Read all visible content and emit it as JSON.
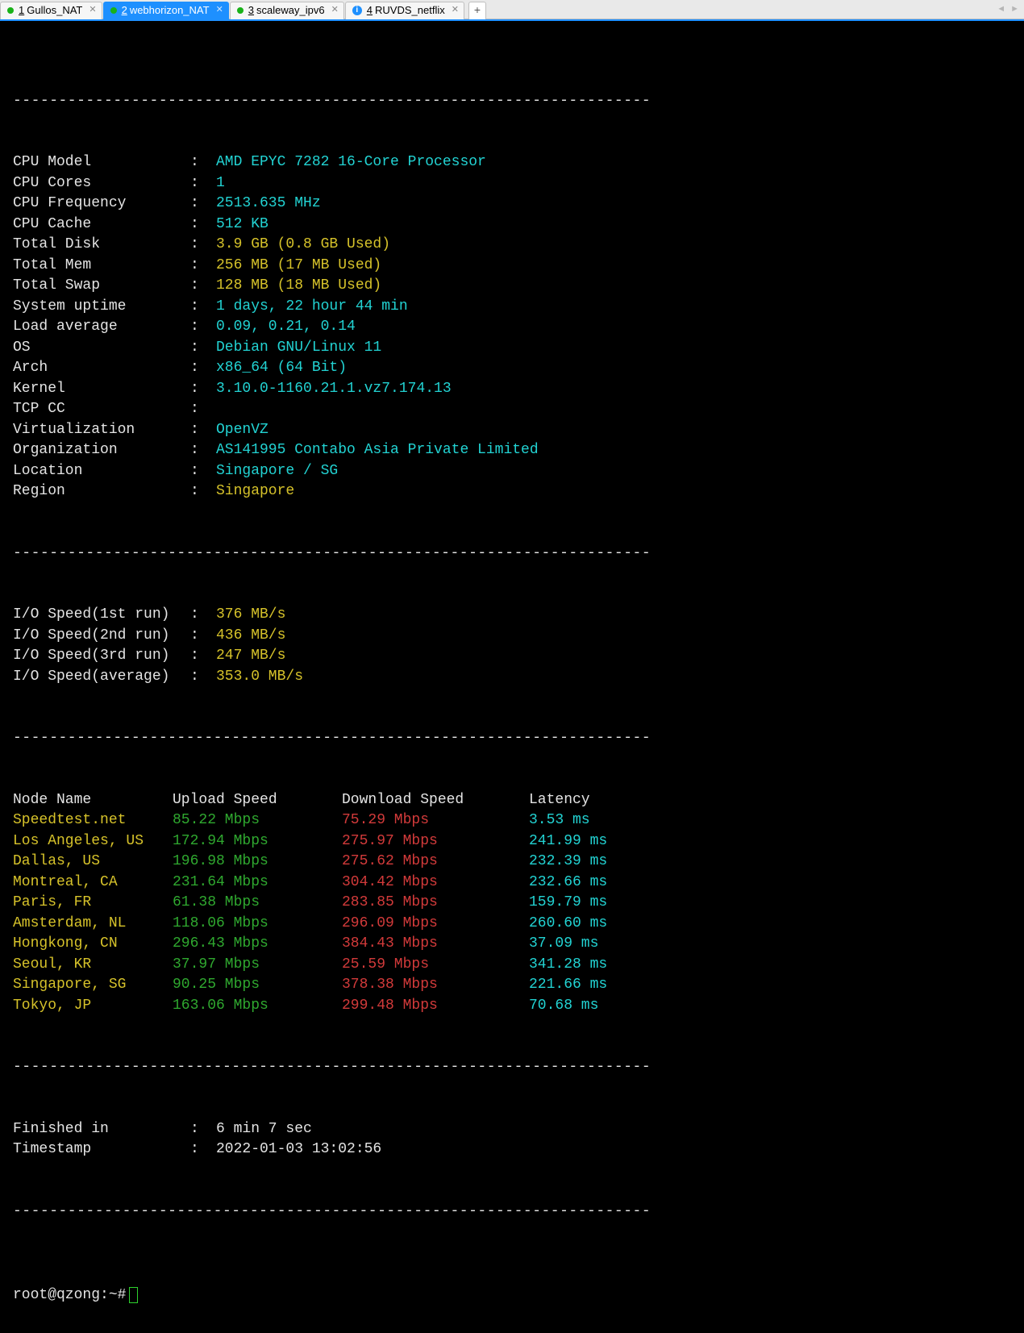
{
  "tabs": [
    {
      "icon": "dot",
      "num": "1",
      "label": "Gullos_NAT",
      "active": false
    },
    {
      "icon": "dot",
      "num": "2",
      "label": "webhorizon_NAT",
      "active": true
    },
    {
      "icon": "dot",
      "num": "3",
      "label": "scaleway_ipv6",
      "active": false
    },
    {
      "icon": "info",
      "num": "4",
      "label": "RUVDS_netflix",
      "active": false
    }
  ],
  "newtab": "+",
  "arrows": {
    "left": "◄",
    "right": "►"
  },
  "sep_line": "----------------------------------------------------------------------",
  "sys": [
    {
      "label": "CPU Model",
      "value": "AMD EPYC 7282 16-Core Processor",
      "color": "cyan"
    },
    {
      "label": "CPU Cores",
      "value": "1",
      "color": "cyan"
    },
    {
      "label": "CPU Frequency",
      "value": "2513.635 MHz",
      "color": "cyan"
    },
    {
      "label": "CPU Cache",
      "value": "512 KB",
      "color": "cyan"
    },
    {
      "label": "Total Disk",
      "value": "3.9 GB (0.8 GB Used)",
      "color": "yellow"
    },
    {
      "label": "Total Mem",
      "value": "256 MB (17 MB Used)",
      "color": "yellow"
    },
    {
      "label": "Total Swap",
      "value": "128 MB (18 MB Used)",
      "color": "yellow"
    },
    {
      "label": "System uptime",
      "value": "1 days, 22 hour 44 min",
      "color": "cyan"
    },
    {
      "label": "Load average",
      "value": "0.09, 0.21, 0.14",
      "color": "cyan"
    },
    {
      "label": "OS",
      "value": "Debian GNU/Linux 11",
      "color": "cyan"
    },
    {
      "label": "Arch",
      "value": "x86_64 (64 Bit)",
      "color": "cyan"
    },
    {
      "label": "Kernel",
      "value": "3.10.0-1160.21.1.vz7.174.13",
      "color": "cyan"
    },
    {
      "label": "TCP CC",
      "value": "",
      "color": "cyan"
    },
    {
      "label": "Virtualization",
      "value": "OpenVZ",
      "color": "cyan"
    },
    {
      "label": "Organization",
      "value": "AS141995 Contabo Asia Private Limited",
      "color": "cyan"
    },
    {
      "label": "Location",
      "value": "Singapore / SG",
      "color": "cyan"
    },
    {
      "label": "Region",
      "value": "Singapore",
      "color": "yellow"
    }
  ],
  "io": [
    {
      "label": "I/O Speed(1st run)",
      "value": "376 MB/s"
    },
    {
      "label": "I/O Speed(2nd run)",
      "value": "436 MB/s"
    },
    {
      "label": "I/O Speed(3rd run)",
      "value": "247 MB/s"
    },
    {
      "label": "I/O Speed(average)",
      "value": "353.0 MB/s"
    }
  ],
  "net_head": {
    "node": "Node Name",
    "up": "Upload Speed",
    "down": "Download Speed",
    "lat": "Latency"
  },
  "net": [
    {
      "node": "Speedtest.net",
      "up": "85.22 Mbps",
      "down": "75.29 Mbps",
      "lat": "3.53 ms"
    },
    {
      "node": "Los Angeles, US",
      "up": "172.94 Mbps",
      "down": "275.97 Mbps",
      "lat": "241.99 ms"
    },
    {
      "node": "Dallas, US",
      "up": "196.98 Mbps",
      "down": "275.62 Mbps",
      "lat": "232.39 ms"
    },
    {
      "node": "Montreal, CA",
      "up": "231.64 Mbps",
      "down": "304.42 Mbps",
      "lat": "232.66 ms"
    },
    {
      "node": "Paris, FR",
      "up": "61.38 Mbps",
      "down": "283.85 Mbps",
      "lat": "159.79 ms"
    },
    {
      "node": "Amsterdam, NL",
      "up": "118.06 Mbps",
      "down": "296.09 Mbps",
      "lat": "260.60 ms"
    },
    {
      "node": "Hongkong, CN",
      "up": "296.43 Mbps",
      "down": "384.43 Mbps",
      "lat": "37.09 ms"
    },
    {
      "node": "Seoul, KR",
      "up": "37.97 Mbps",
      "down": "25.59 Mbps",
      "lat": "341.28 ms"
    },
    {
      "node": "Singapore, SG",
      "up": "90.25 Mbps",
      "down": "378.38 Mbps",
      "lat": "221.66 ms"
    },
    {
      "node": "Tokyo, JP",
      "up": "163.06 Mbps",
      "down": "299.48 Mbps",
      "lat": "70.68 ms"
    }
  ],
  "footer": [
    {
      "label": "Finished in",
      "value": "6 min 7 sec"
    },
    {
      "label": "Timestamp",
      "value": "2022-01-03 13:02:56"
    }
  ],
  "prompt": "root@qzong:~#"
}
